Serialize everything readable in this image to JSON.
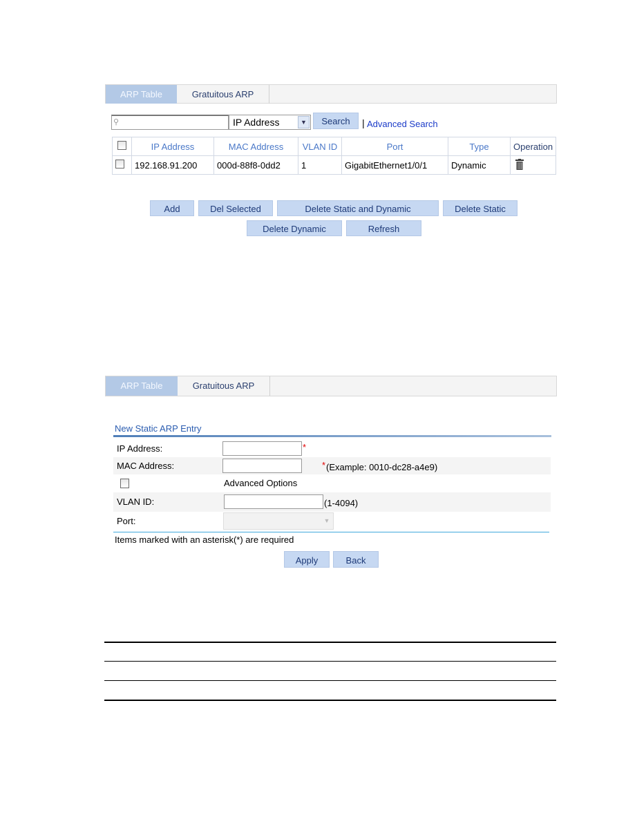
{
  "screen1": {
    "tabs": [
      {
        "label": "ARP Table",
        "active": true
      },
      {
        "label": "Gratuitous ARP",
        "active": false
      }
    ],
    "search": {
      "value": "",
      "placeholder": "",
      "field_select": "IP Address",
      "search_label": "Search",
      "advanced_label": "Advanced Search",
      "separator": "|"
    },
    "table": {
      "headers": [
        "IP Address",
        "MAC Address",
        "VLAN ID",
        "Port",
        "Type",
        "Operation"
      ],
      "rows": [
        {
          "ip": "192.168.91.200",
          "mac": "000d-88f8-0dd2",
          "vlan": "1",
          "port": "GigabitEthernet1/0/1",
          "type": "Dynamic",
          "operation_icon": "trash-icon"
        }
      ]
    },
    "buttons": [
      "Add",
      "Del Selected",
      "Delete Static and Dynamic",
      "Delete Static",
      "Delete Dynamic",
      "Refresh"
    ]
  },
  "screen2": {
    "tabs": [
      {
        "label": "ARP Table",
        "active": true
      },
      {
        "label": "Gratuitous ARP",
        "active": false
      }
    ],
    "section_title": "New Static ARP Entry",
    "fields": {
      "ip_label": "IP Address:",
      "ip_value": "",
      "required_mark": "*",
      "mac_label": "MAC Address:",
      "mac_value": "",
      "mac_hint": "(Example: 0010-dc28-a4e9)",
      "advanced_label": "Advanced Options",
      "advanced_checked": false,
      "vlan_label": "VLAN ID:",
      "vlan_value": "",
      "vlan_hint": "(1-4094)",
      "port_label": "Port:",
      "port_value": ""
    },
    "note": "Items marked with an asterisk(*) are required",
    "apply_label": "Apply",
    "back_label": "Back"
  },
  "colors": {
    "accent": "#4a78c8",
    "button_bg": "#c6d8f2",
    "tab_active": "#b3c9e6",
    "required": "#e00000"
  }
}
